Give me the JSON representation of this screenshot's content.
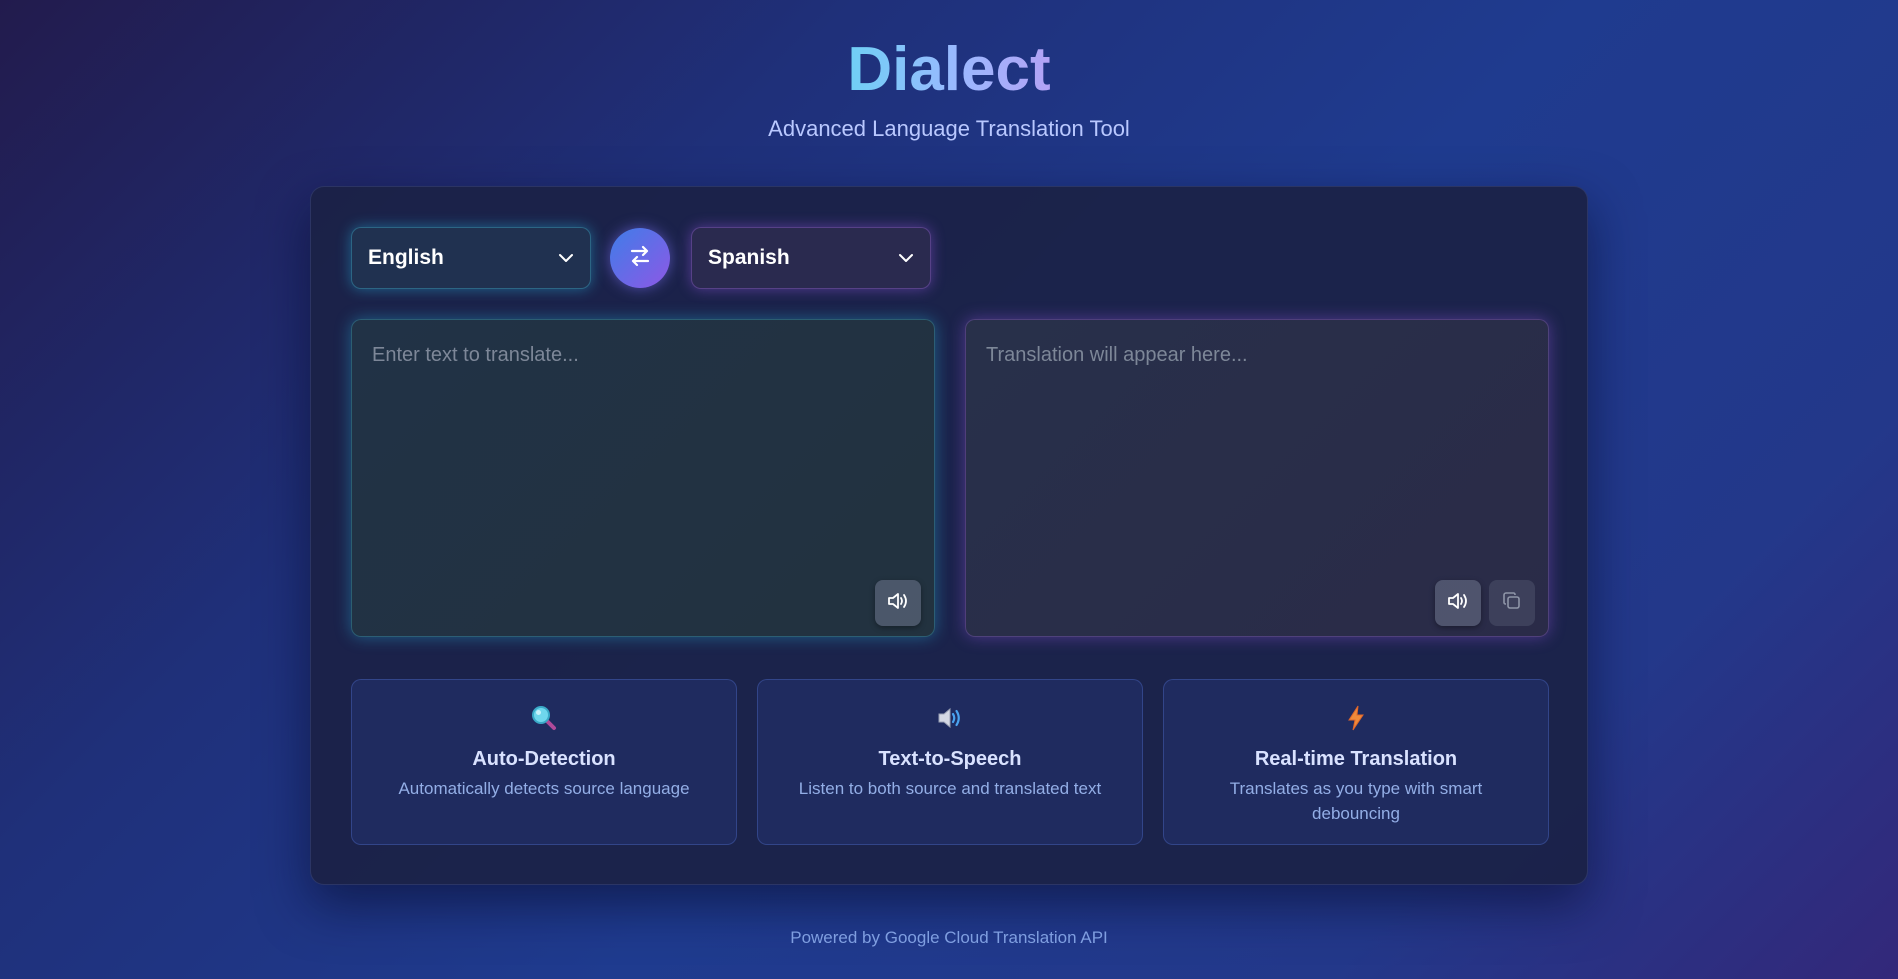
{
  "header": {
    "title": "Dialect",
    "subtitle": "Advanced Language Translation Tool"
  },
  "languages": {
    "source": "English",
    "target": "Spanish",
    "swap_icon": "swap-arrows-icon"
  },
  "source_panel": {
    "placeholder": "Enter text to translate...",
    "value": "",
    "speak_icon": "speaker-icon"
  },
  "target_panel": {
    "placeholder": "Translation will appear here...",
    "speak_icon": "speaker-icon",
    "copy_icon": "copy-icon"
  },
  "features": [
    {
      "icon": "magnifier-icon",
      "title": "Auto-Detection",
      "description": "Automatically detects source language"
    },
    {
      "icon": "speaker-icon",
      "title": "Text-to-Speech",
      "description": "Listen to both source and translated text"
    },
    {
      "icon": "lightning-icon",
      "title": "Real-time Translation",
      "description": "Translates as you type with smart debouncing"
    }
  ],
  "footer": "Powered by Google Cloud Translation API",
  "colors": {
    "accent_cyan": "#46c8e6",
    "accent_purple": "#a06ef0",
    "swap_gradient_start": "#3f7de8",
    "swap_gradient_end": "#8d58e6"
  }
}
